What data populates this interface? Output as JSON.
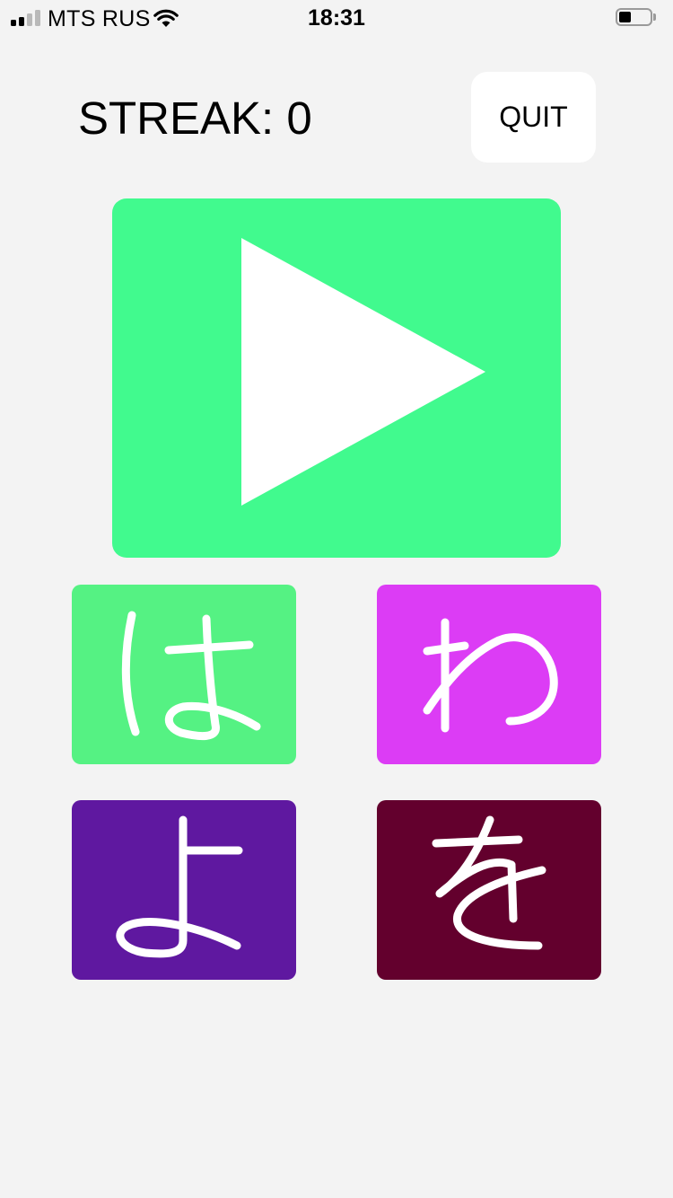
{
  "status_bar": {
    "carrier": "MTS RUS",
    "time": "18:31",
    "signal_bars_active": 2,
    "signal_bars_total": 4,
    "battery_level": 0.4,
    "icons": [
      "signal-icon",
      "wifi-icon",
      "battery-icon"
    ]
  },
  "header": {
    "streak_text": "STREAK: 0",
    "quit_label": "QUIT"
  },
  "play": {
    "icon": "play-icon",
    "color": "#41fa8e"
  },
  "answers": [
    {
      "char": "は",
      "color": "#55f283"
    },
    {
      "char": "わ",
      "color": "#dc3cf5"
    },
    {
      "char": "よ",
      "color": "#5f18a0"
    },
    {
      "char": "を",
      "color": "#63002d"
    }
  ],
  "colors": {
    "background": "#f3f3f3",
    "quit_button": "#ffffff",
    "icon_fill": "#ffffff"
  }
}
